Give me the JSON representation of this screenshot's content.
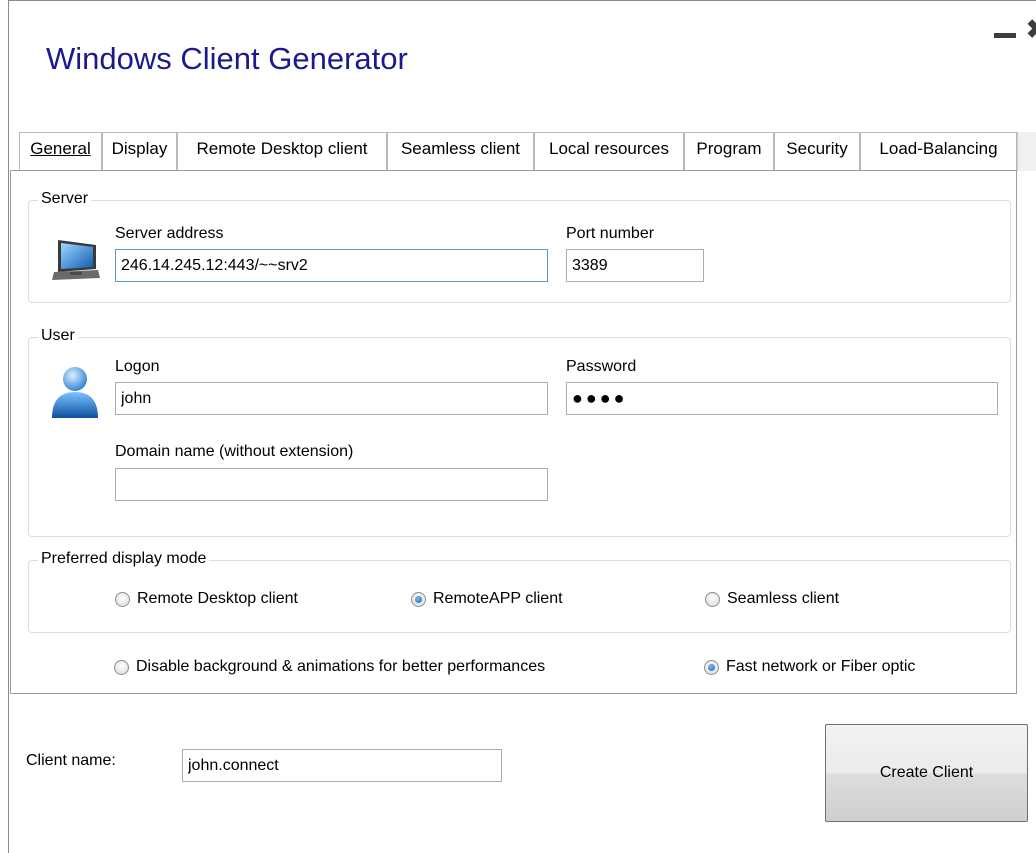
{
  "window": {
    "title": "Windows Client Generator"
  },
  "tabs": [
    {
      "label": "General"
    },
    {
      "label": "Display"
    },
    {
      "label": "Remote Desktop client"
    },
    {
      "label": "Seamless client"
    },
    {
      "label": "Local resources"
    },
    {
      "label": "Program"
    },
    {
      "label": "Security"
    },
    {
      "label": "Load-Balancing"
    }
  ],
  "server": {
    "legend": "Server",
    "address_label": "Server address",
    "address_value": "246.14.245.12:443/~~srv2",
    "port_label": "Port number",
    "port_value": "3389"
  },
  "user": {
    "legend": "User",
    "logon_label": "Logon",
    "logon_value": "john",
    "password_label": "Password",
    "password_value": "●●●●",
    "domain_label": "Domain name (without extension)",
    "domain_value": ""
  },
  "display_mode": {
    "legend": "Preferred display mode",
    "options": [
      {
        "label": "Remote Desktop client",
        "checked": false
      },
      {
        "label": "RemoteAPP client",
        "checked": true
      },
      {
        "label": "Seamless client",
        "checked": false
      }
    ]
  },
  "performance": {
    "disable_bg_label": "Disable background & animations for better performances",
    "disable_bg_checked": false,
    "fast_network_label": "Fast network or Fiber optic",
    "fast_network_checked": true
  },
  "client": {
    "name_label": "Client name:",
    "name_value": "john.connect"
  },
  "actions": {
    "create_label": "Create Client"
  },
  "colors": {
    "title": "#1a1a8c",
    "group_border": "#d5dfe5",
    "focus_border": "#5a9bd5"
  },
  "icons": {
    "server": "computer-monitor-icon",
    "user": "user-avatar-icon",
    "minimize": "minimize-icon",
    "close": "close-icon"
  }
}
